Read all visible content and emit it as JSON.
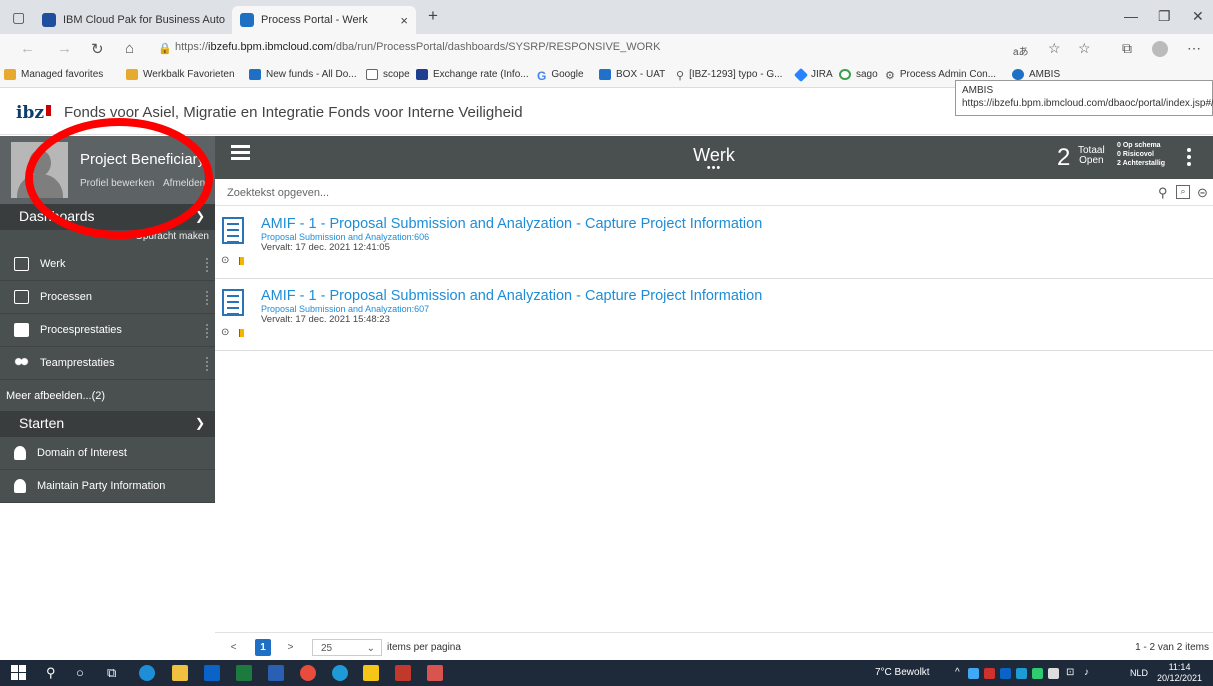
{
  "browser": {
    "tabs": [
      {
        "label": "IBM Cloud Pak for Business Auto",
        "close": "×"
      },
      {
        "label": "Process Portal - Werk",
        "close": "×"
      }
    ],
    "new_tab": "+",
    "url_prefix": "https://",
    "url_host": "ibzefu.bpm.ibmcloud.com",
    "url_path": "/dba/run/ProcessPortal/dashboards/SYSRP/RESPONSIVE_WORK",
    "favorites": [
      {
        "label": "Managed favorites",
        "color": "#e8a92f"
      },
      {
        "label": "Werkbalk Favorieten",
        "color": "#e8a92f"
      },
      {
        "label": "New funds - All Do...",
        "color": "#1f6fc4"
      },
      {
        "label": "scope",
        "color": "#666666"
      },
      {
        "label": "Exchange rate (Info...",
        "color": "#1e3f8f"
      },
      {
        "label": "Google",
        "color": "#4285f4"
      },
      {
        "label": "BOX - UAT",
        "color": "#2170c9"
      },
      {
        "label": "[IBZ-1293] typo - G...",
        "color": "#555555"
      },
      {
        "label": "JIRA",
        "color": "#2684ff"
      },
      {
        "label": "sago",
        "color": "#3a9f4f"
      },
      {
        "label": "Process Admin Con...",
        "color": "#555555"
      },
      {
        "label": "AMBIS",
        "color": "#1f6fc4"
      }
    ],
    "tooltip": {
      "title": "AMBIS",
      "url": "https://ibzefu.bpm.ibmcloud.com/dbaoc/portal/index.jsp#/"
    }
  },
  "portal": {
    "logo": "ibz",
    "agency": "Fonds voor Asiel, Migratie en Integratie Fonds voor Interne Veiligheid"
  },
  "sidebar": {
    "user": "Project Beneficiary",
    "edit_profile": "Profiel bewerken",
    "logout": "Afmelden",
    "dashboards_header": "Dashboards",
    "dashboards_sub": "Opdracht maken",
    "items": [
      {
        "label": "Werk"
      },
      {
        "label": "Processen"
      },
      {
        "label": "Procesprestaties"
      },
      {
        "label": "Teamprestaties"
      }
    ],
    "more": "Meer afbeelden...(2)",
    "start_header": "Starten",
    "start_items": [
      {
        "label": "Domain of Interest"
      },
      {
        "label": "Maintain Party Information"
      }
    ]
  },
  "main": {
    "title": "Werk",
    "title_dots": "•••",
    "total_num": "2",
    "total_label_1": "Totaal",
    "total_label_2": "Open",
    "stats": [
      "0 Op schema",
      "0 Risicovol",
      "2 Achterstallig"
    ],
    "search_placeholder": "Zoektekst opgeven...",
    "tasks": [
      {
        "title": "AMIF - 1 - Proposal Submission and Analyzation - Capture Project Information",
        "subtitle": "Proposal Submission and Analyzation:606",
        "due": "Vervalt: 17 dec. 2021 12:41:05"
      },
      {
        "title": "AMIF - 1 - Proposal Submission and Analyzation - Capture Project Information",
        "subtitle": "Proposal Submission and Analyzation:607",
        "due": "Vervalt: 17 dec. 2021 15:48:23"
      }
    ],
    "pager": {
      "prev": "<",
      "current": "1",
      "next": ">",
      "page_size": "25",
      "page_size_label": "items per pagina",
      "range": "1 - 2 van 2 items"
    }
  },
  "taskbar": {
    "weather": "7°C Bewolkt",
    "lang": "NLD",
    "time": "11:14",
    "date": "20/12/2021"
  },
  "colors": {
    "sidebar": "#4a4f50",
    "link": "#1f8dd6",
    "annotation": "#ff0000"
  }
}
